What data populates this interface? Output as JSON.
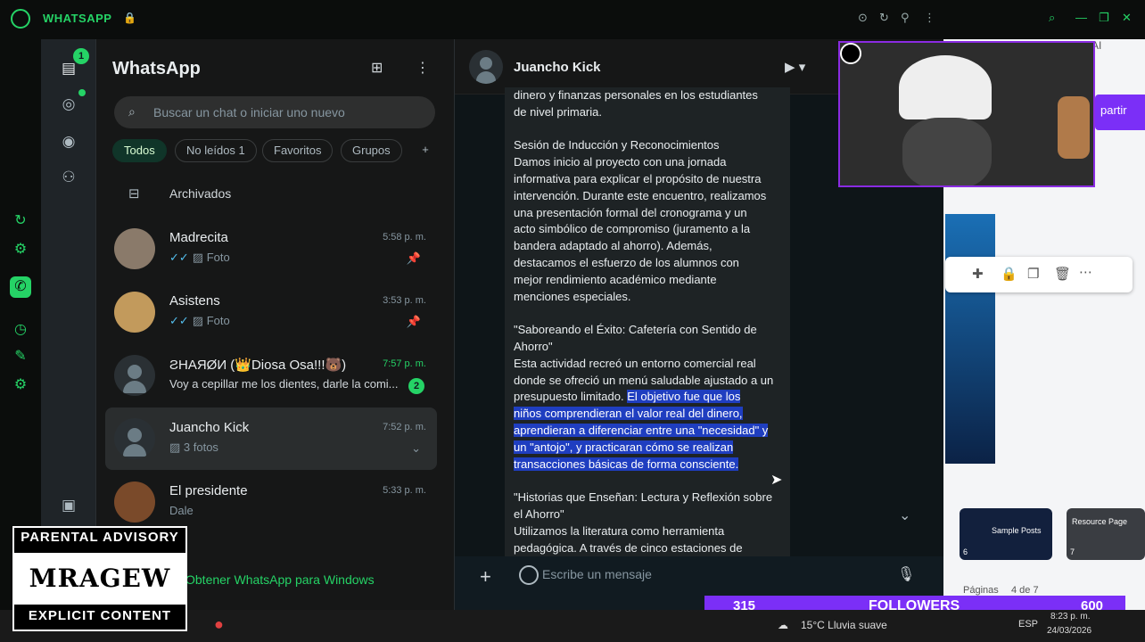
{
  "titlebar": {
    "app_name": "WHATSAPP"
  },
  "sidebar": {
    "badge": "1"
  },
  "chatlist": {
    "title": "WhatsApp",
    "search_placeholder": "Buscar un chat o iniciar uno nuevo",
    "filters": [
      "Todos",
      "No leídos 1",
      "Favoritos",
      "Grupos"
    ],
    "archived_label": "Archivados",
    "chats": [
      {
        "name": "Madrecita",
        "time": "5:58 p. m.",
        "preview": "Foto",
        "pinned": true
      },
      {
        "name": "Asistens",
        "time": "3:53 p. m.",
        "preview": "Foto",
        "pinned": true
      },
      {
        "name": "ƧHAЯØИ (👑Diosa Osa!!!🐻)",
        "time": "7:57 p. m.",
        "preview": "Voy a cepillar me los dientes, darle la comi...",
        "unread": "2"
      },
      {
        "name": "Juancho Kick",
        "time": "7:52 p. m.",
        "preview": "3 fotos"
      },
      {
        "name": "El presidente",
        "time": "5:33 p. m.",
        "preview": "Dale"
      }
    ],
    "footer_link": "Obtener WhatsApp para Windows"
  },
  "conversation": {
    "contact": "Juancho Kick",
    "composer_placeholder": "Escribe un mensaje",
    "message_lines": [
      "dinero y finanzas personales en los estudiantes",
      "de nivel primaria.",
      "",
      "Sesión de Inducción y Reconocimientos",
      "Damos inicio al proyecto con una jornada",
      "informativa para explicar el propósito de nuestra",
      "intervención. Durante este encuentro, realizamos",
      "una presentación formal del cronograma y un",
      "acto simbólico de compromiso (juramento a la",
      "bandera adaptado al ahorro). Además,",
      "destacamos el esfuerzo de los alumnos con",
      "mejor rendimiento académico mediante",
      "menciones especiales.",
      "",
      "\"Saboreando el Éxito: Cafetería con Sentido de",
      "Ahorro\"",
      "Esta actividad recreó un entorno comercial real",
      "donde se ofreció un menú saludable ajustado a un"
    ],
    "highlight_prefix": "presupuesto limitado. ",
    "highlight_lines": [
      "El objetivo fue que los",
      "niños comprendieran el valor real del dinero,",
      "aprendieran a diferenciar entre una \"necesidad\" y",
      "un \"antojo\", y practicaran cómo se realizan",
      "transacciones básicas de forma consciente."
    ],
    "after_lines": [
      "",
      "\"Historias que Enseñan: Lectura y Reflexión sobre",
      "el Ahorro\"",
      "Utilizamos la literatura como herramienta",
      "pedagógica. A través de cinco estaciones de"
    ]
  },
  "rightapp": {
    "share_label": "partir",
    "ai_label": "AI",
    "pages_label": "Páginas",
    "page_count": "4 de 7",
    "thumbs": [
      {
        "num": "6",
        "title": "Sample Posts"
      },
      {
        "num": "7",
        "title": "Resource Page"
      }
    ]
  },
  "overlay": {
    "followers_left": "315",
    "followers_label": "FOLLOWERS",
    "followers_right": "600",
    "pa_top": "PARENTAL ADVISORY",
    "pa_mid": "MRAGEW",
    "pa_bottom": "EXPLICIT CONTENT"
  },
  "taskbar": {
    "weather": "15°C  Lluvia suave",
    "lang": "ESP",
    "time": "8:23 p. m.",
    "date": "24/03/2026"
  }
}
